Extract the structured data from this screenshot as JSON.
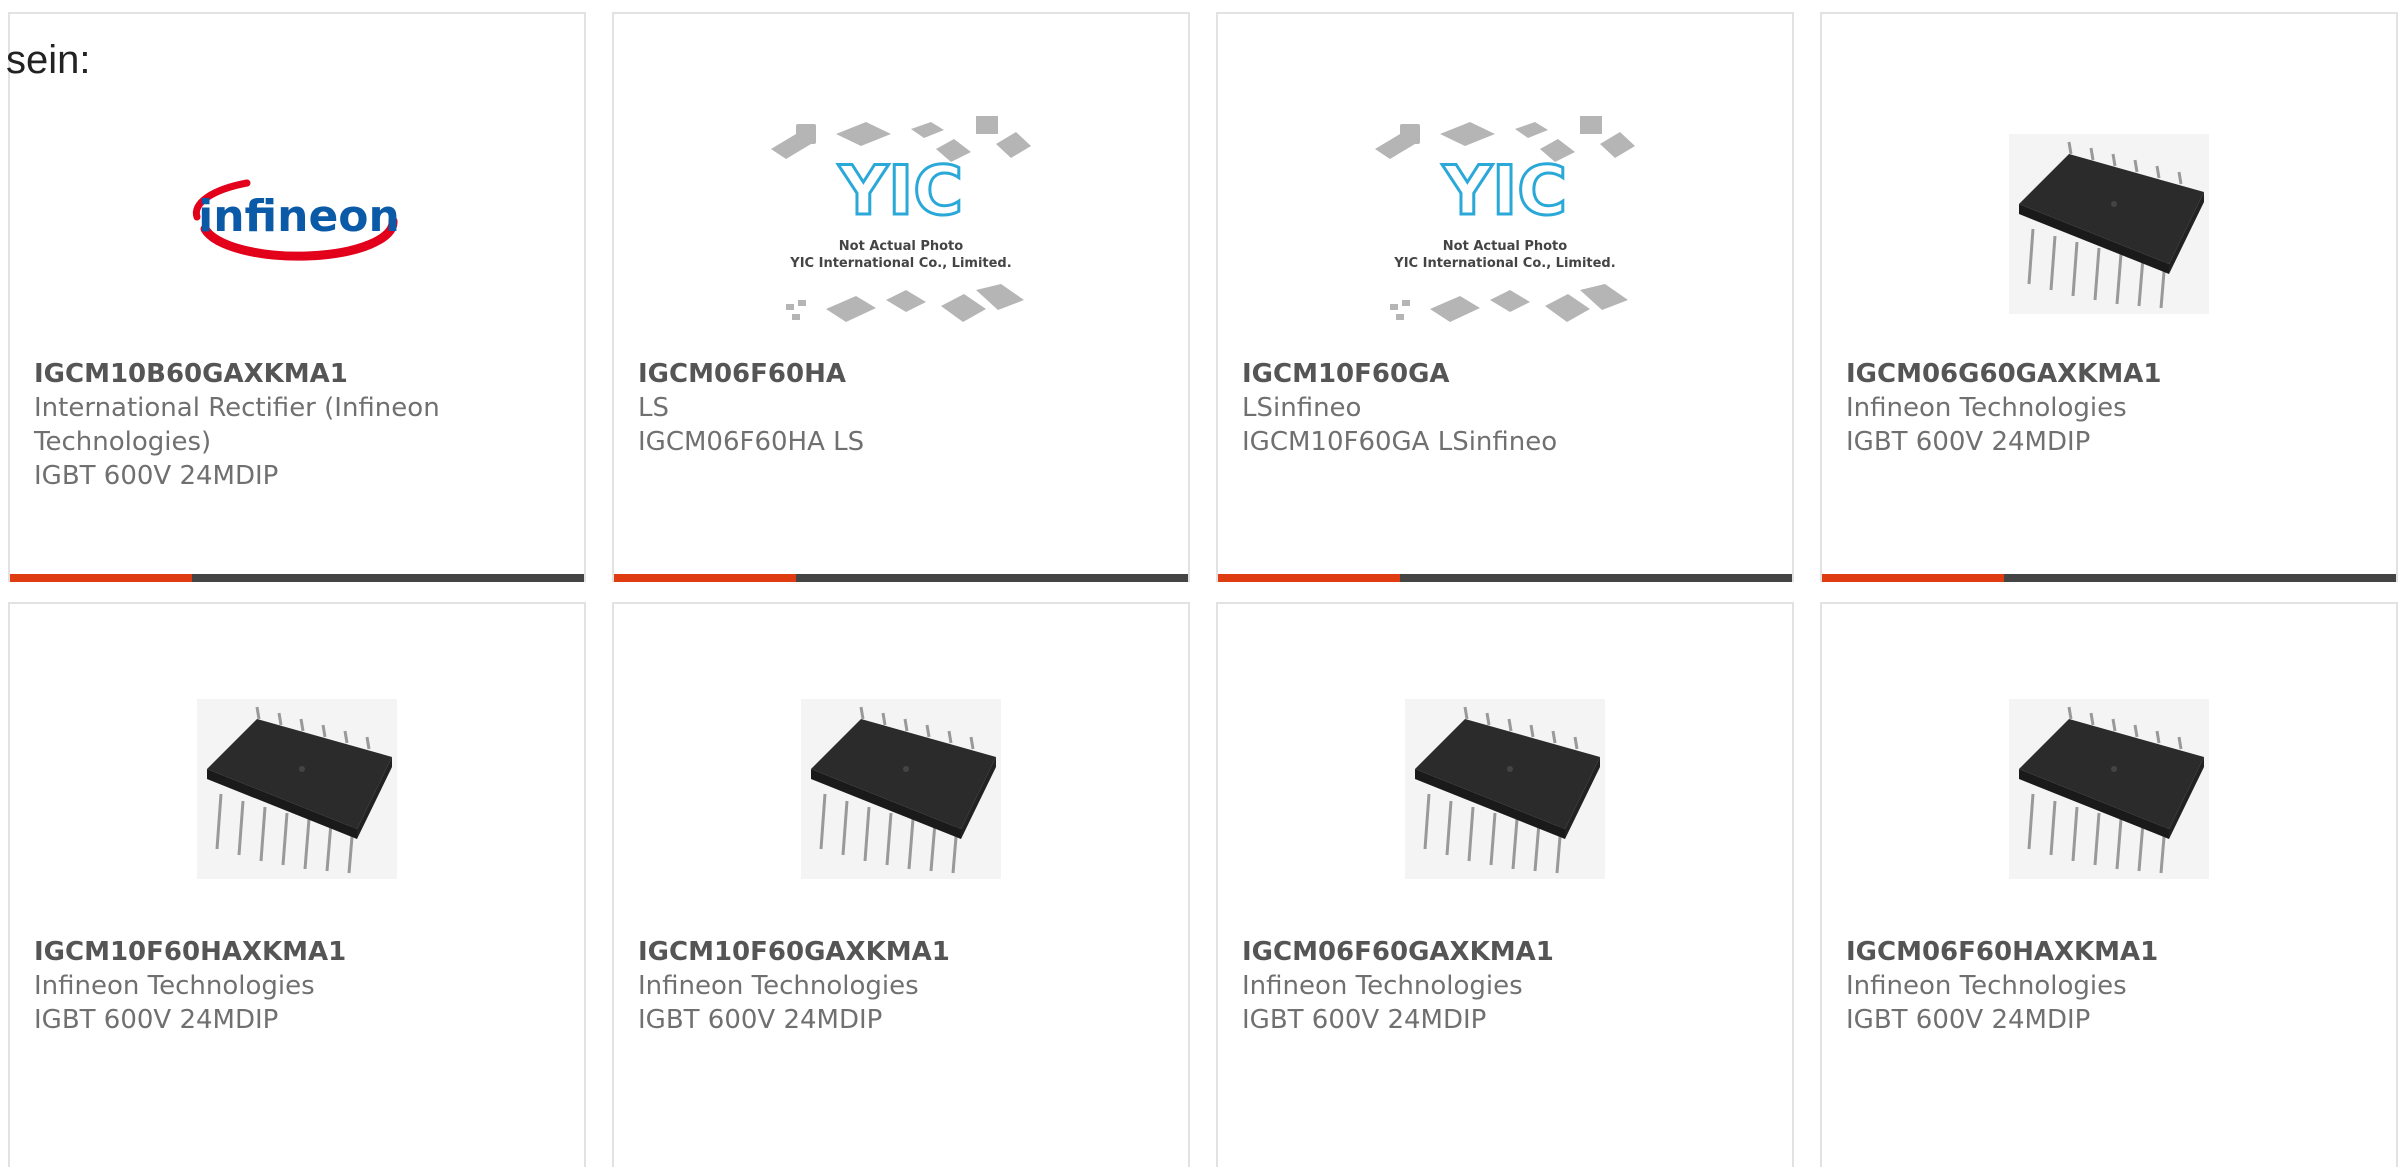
{
  "intro_text": "sein:",
  "products": [
    {
      "name": "IGCM10B60GAXKMA1",
      "maker": "International Rectifier (Infineon Technologies)",
      "desc": "IGBT 600V 24MDIP",
      "image": "infineon-logo"
    },
    {
      "name": "IGCM06F60HA",
      "maker": "LS",
      "desc": "IGCM06F60HA LS",
      "image": "yic-placeholder"
    },
    {
      "name": "IGCM10F60GA",
      "maker": "LSinfineo",
      "desc": "IGCM10F60GA LSinfineo",
      "image": "yic-placeholder"
    },
    {
      "name": "IGCM06G60GAXKMA1",
      "maker": "Infineon Technologies",
      "desc": "IGBT 600V 24MDIP",
      "image": "chip-photo"
    },
    {
      "name": "IGCM10F60HAXKMA1",
      "maker": "Infineon Technologies",
      "desc": "IGBT 600V 24MDIP",
      "image": "chip-photo"
    },
    {
      "name": "IGCM10F60GAXKMA1",
      "maker": "Infineon Technologies",
      "desc": "IGBT 600V 24MDIP",
      "image": "chip-photo"
    },
    {
      "name": "IGCM06F60GAXKMA1",
      "maker": "Infineon Technologies",
      "desc": "IGBT 600V 24MDIP",
      "image": "chip-photo"
    },
    {
      "name": "IGCM06F60HAXKMA1",
      "maker": "Infineon Technologies",
      "desc": "IGBT 600V 24MDIP",
      "image": "chip-photo"
    }
  ],
  "logo_text": "infineon",
  "placeholder": {
    "line1": "Not Actual Photo",
    "line2": "YIC International Co., Limited."
  },
  "colors": {
    "accent": "#e03c12",
    "bar": "#444444",
    "border": "#e2e2e2",
    "infineon_red": "#e2001a",
    "infineon_blue": "#0a5aa8"
  }
}
